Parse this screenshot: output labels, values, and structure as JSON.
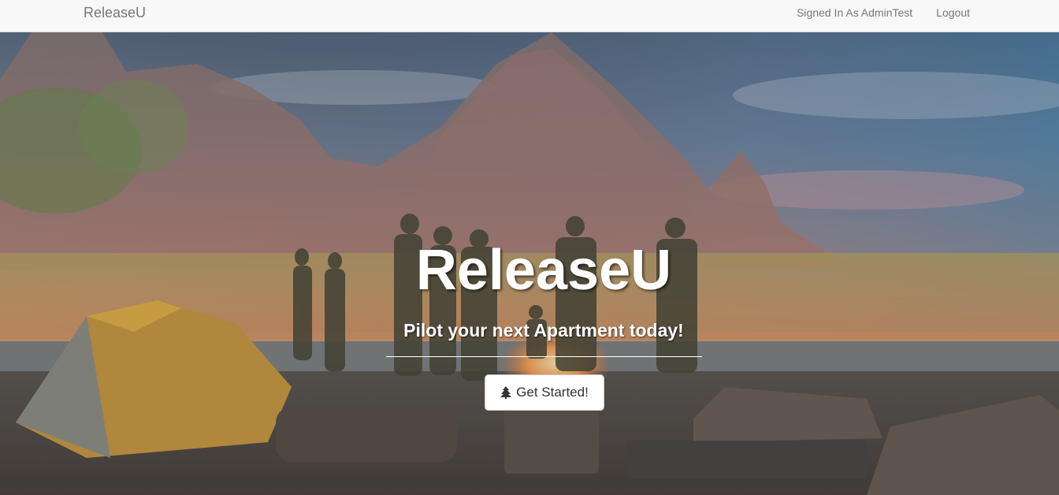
{
  "navbar": {
    "brand": "ReleaseU",
    "signed_in_label": "Signed In As AdminTest",
    "logout_label": "Logout"
  },
  "hero": {
    "title": "ReleaseU",
    "subtitle": "Pilot your next Apartment today!",
    "cta_label": "Get Started!",
    "cta_icon": "tree-icon",
    "background": "campfire-beach-mountain-photo"
  },
  "colors": {
    "navbar_bg": "#f8f8f8",
    "nav_text": "#777777",
    "hero_text": "#ffffff",
    "button_bg": "#ffffff",
    "button_text": "#333333"
  }
}
